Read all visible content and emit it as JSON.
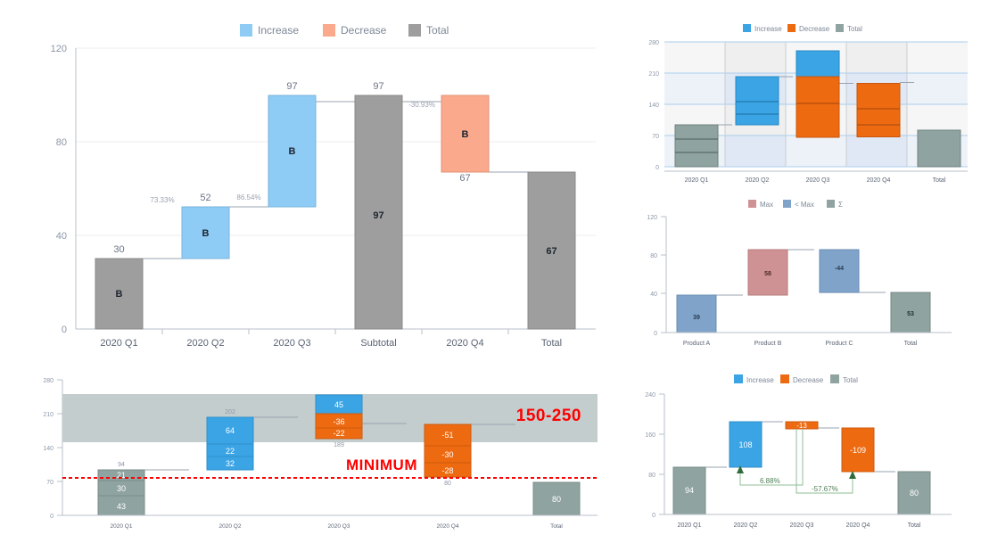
{
  "charts": [
    {
      "id": "waterfall-quarterly-main",
      "legend": [
        {
          "label": "Increase",
          "color": "#8ecbf5"
        },
        {
          "label": "Decrease",
          "color": "#faa98c"
        },
        {
          "label": "Total",
          "color": "#9e9e9e"
        }
      ],
      "chart_data": {
        "type": "bar",
        "title": "",
        "xlabel": "",
        "ylabel": "",
        "ylim": [
          0,
          120
        ],
        "yticks": [
          0,
          40,
          80,
          120
        ],
        "grid": true,
        "legend_position": "top",
        "categories": [
          "2020 Q1",
          "2020 Q2",
          "2020 Q3",
          "Subtotal",
          "2020 Q4",
          "Total"
        ],
        "kinds": [
          "total",
          "increase",
          "increase",
          "total",
          "decrease",
          "total"
        ],
        "bar_start": [
          0,
          30,
          52,
          0,
          67,
          0
        ],
        "bar_end": [
          30,
          52,
          97,
          97,
          97,
          67
        ],
        "values": [
          30,
          22,
          45,
          97,
          -30,
          67
        ],
        "end_labels": [
          "30",
          "52",
          "97",
          "97",
          "67",
          ""
        ],
        "inside_labels": [
          "B",
          "B",
          "B",
          "97",
          "B",
          "67"
        ],
        "pct_labels": [
          "73.33%",
          "86.54%",
          "",
          "-30.93%",
          ""
        ]
      }
    },
    {
      "id": "waterfall-banded-boxes",
      "legend": [
        {
          "label": "Increase",
          "color": "#3ba4e5"
        },
        {
          "label": "Decrease",
          "color": "#ee6a10"
        },
        {
          "label": "Total",
          "color": "#8fa3a0"
        }
      ],
      "chart_data": {
        "type": "bar",
        "ylim": [
          0,
          280
        ],
        "yticks": [
          0,
          70,
          140,
          210,
          280
        ],
        "grid": true,
        "legend_position": "top",
        "categories": [
          "2020 Q1",
          "2020 Q2",
          "2020 Q3",
          "2020 Q4",
          "Total"
        ],
        "kinds": [
          "total",
          "increase",
          "decrease",
          "decrease",
          "total"
        ],
        "bar_start": [
          0,
          94,
          202,
          80,
          0
        ],
        "bar_end": [
          94,
          202,
          247,
          189,
          80
        ],
        "segments": [
          [
            43,
            30,
            21
          ],
          [
            32,
            22,
            64
          ],
          [
            45,
            -36,
            -22
          ],
          [
            -51,
            -30,
            -28
          ],
          [
            80
          ]
        ],
        "values": [
          94,
          108,
          -13,
          -109,
          80
        ]
      }
    },
    {
      "id": "waterfall-products-max",
      "legend": [
        {
          "label": "Max",
          "color": "#cf9294"
        },
        {
          "label": "< Max",
          "color": "#7fa3c9"
        },
        {
          "label": "Σ",
          "color": "#8fa3a0"
        }
      ],
      "chart_data": {
        "type": "bar",
        "ylim": [
          0,
          120
        ],
        "yticks": [
          0,
          40,
          80,
          120
        ],
        "grid": false,
        "legend_position": "top",
        "categories": [
          "Product A",
          "Product B",
          "Product C",
          "Total"
        ],
        "kinds": [
          "lessmax",
          "max",
          "lessmax",
          "sum"
        ],
        "bar_start": [
          0,
          39,
          53,
          0
        ],
        "bar_end": [
          39,
          97,
          97,
          53
        ],
        "values": [
          39,
          58,
          -44,
          53
        ],
        "inside_labels": [
          "39",
          "58",
          "-44",
          "53"
        ]
      }
    },
    {
      "id": "waterfall-stacked-minimum",
      "annotations": [
        {
          "name": "minimum-label",
          "text": "MINIMUM",
          "color": "#ff0000"
        },
        {
          "name": "range-label",
          "text": "150-250",
          "color": "#ff0000"
        }
      ],
      "chart_data": {
        "type": "bar",
        "ylim": [
          0,
          280
        ],
        "yticks": [
          0,
          70,
          140,
          210,
          280
        ],
        "grid": false,
        "legend_position": "none",
        "categories": [
          "2020 Q1",
          "2020 Q2",
          "2020 Q3",
          "2020 Q4",
          "Total"
        ],
        "band": {
          "from": 150,
          "to": 250,
          "color": "#c3cdcd",
          "label": "150-250"
        },
        "threshold": {
          "value": 78,
          "color": "#ff0000",
          "style": "dotted",
          "label": "MINIMUM"
        },
        "kinds": [
          "total",
          "increase",
          "mixed",
          "decrease",
          "total"
        ],
        "bar_start": [
          0,
          94,
          189,
          80,
          0
        ],
        "bar_end": [
          94,
          202,
          247,
          189,
          80
        ],
        "top_labels": [
          "94",
          "202",
          "",
          "",
          ""
        ],
        "bottom_labels": [
          "",
          "",
          "189",
          "80",
          ""
        ],
        "stacks": [
          [
            {
              "v": "21",
              "color": "#8fa3a0"
            },
            {
              "v": "30",
              "color": "#8fa3a0"
            },
            {
              "v": "43",
              "color": "#8fa3a0"
            }
          ],
          [
            {
              "v": "64",
              "color": "#3ba4e5"
            },
            {
              "v": "22",
              "color": "#3ba4e5"
            },
            {
              "v": "32",
              "color": "#3ba4e5"
            }
          ],
          [
            {
              "v": "45",
              "color": "#3ba4e5"
            },
            {
              "v": "-36",
              "color": "#ee6a10"
            },
            {
              "v": "-22",
              "color": "#ee6a10"
            }
          ],
          [
            {
              "v": "-51",
              "color": "#ee6a10"
            },
            {
              "v": "-30",
              "color": "#ee6a10"
            },
            {
              "v": "-28",
              "color": "#ee6a10"
            }
          ],
          [
            {
              "v": "80",
              "color": "#8fa3a0"
            }
          ]
        ]
      }
    },
    {
      "id": "waterfall-pct-arrows",
      "legend": [
        {
          "label": "Increase",
          "color": "#3ba4e5"
        },
        {
          "label": "Decrease",
          "color": "#ee6a10"
        },
        {
          "label": "Total",
          "color": "#8fa3a0"
        }
      ],
      "chart_data": {
        "type": "bar",
        "ylim": [
          0,
          240
        ],
        "yticks": [
          0,
          80,
          160,
          240
        ],
        "grid": false,
        "legend_position": "top",
        "categories": [
          "2020 Q1",
          "2020 Q2",
          "2020 Q3",
          "2020 Q4",
          "Total"
        ],
        "kinds": [
          "total",
          "increase",
          "decrease",
          "decrease",
          "total"
        ],
        "bar_start": [
          0,
          94,
          189,
          80,
          0
        ],
        "bar_end": [
          94,
          202,
          202,
          189,
          80
        ],
        "values": [
          94,
          108,
          -13,
          -109,
          80
        ],
        "inside_labels": [
          "94",
          "108",
          "-13",
          "-109",
          "80"
        ],
        "annotations": [
          {
            "name": "pct-q2",
            "text": "6.88%",
            "color": "#4e7f55"
          },
          {
            "name": "pct-q4",
            "text": "-57.67%",
            "color": "#4e7f55"
          }
        ]
      }
    }
  ]
}
